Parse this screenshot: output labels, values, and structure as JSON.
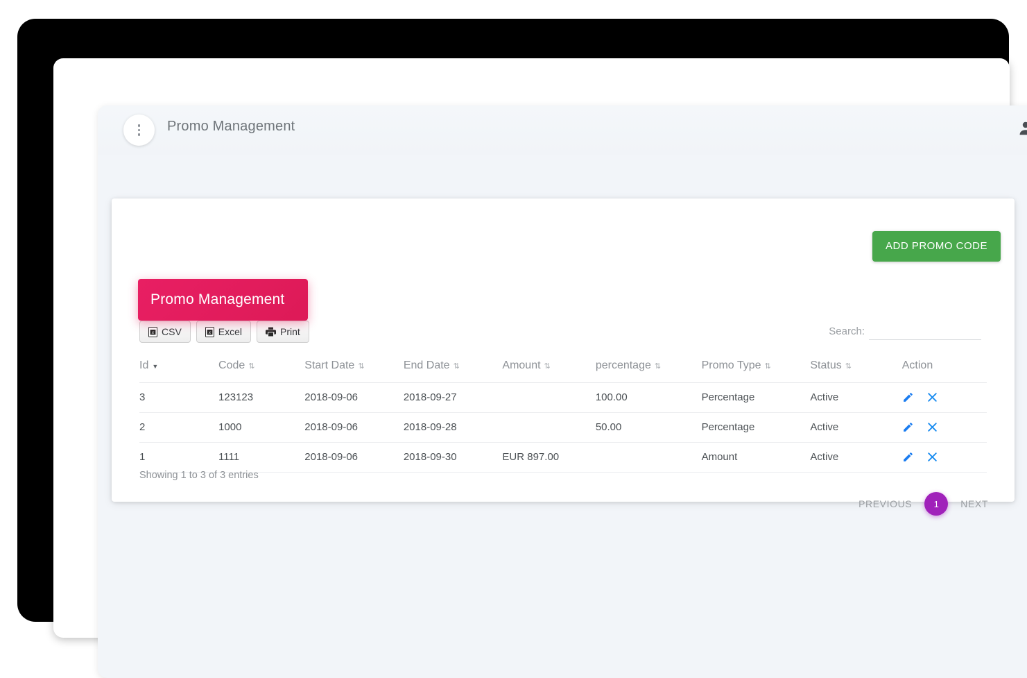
{
  "topbar": {
    "title": "Promo Management",
    "menu_icon": "more-vert-icon",
    "user_icon": "user-account-icon"
  },
  "card": {
    "ribbon_title": "Promo Management",
    "ribbon_color": "#e0245e",
    "add_button_label": "ADD PROMO CODE",
    "add_button_color": "#4caf50"
  },
  "export_buttons": [
    {
      "label": "CSV",
      "icon": "file-excel-icon"
    },
    {
      "label": "Excel",
      "icon": "file-excel-icon"
    },
    {
      "label": "Print",
      "icon": "printer-icon"
    }
  ],
  "search": {
    "label": "Search:",
    "value": "",
    "placeholder": ""
  },
  "table": {
    "columns": [
      {
        "label": "Id",
        "sortable": true,
        "sorted": "desc"
      },
      {
        "label": "Code",
        "sortable": true,
        "sorted": "none"
      },
      {
        "label": "Start Date",
        "sortable": true,
        "sorted": "none"
      },
      {
        "label": "End Date",
        "sortable": true,
        "sorted": "none"
      },
      {
        "label": "Amount",
        "sortable": true,
        "sorted": "none"
      },
      {
        "label": "percentage",
        "sortable": true,
        "sorted": "none"
      },
      {
        "label": "Promo Type",
        "sortable": true,
        "sorted": "none"
      },
      {
        "label": "Status",
        "sortable": true,
        "sorted": "none"
      },
      {
        "label": "Action",
        "sortable": false,
        "sorted": "none"
      }
    ],
    "rows": [
      {
        "id": "3",
        "code": "123123",
        "start_date": "2018-09-06",
        "end_date": "2018-09-27",
        "amount": "",
        "percentage": "100.00",
        "promo_type": "Percentage",
        "status": "Active",
        "edit_icon": "pencil-icon",
        "delete_icon": "close-x-icon"
      },
      {
        "id": "2",
        "code": "1000",
        "start_date": "2018-09-06",
        "end_date": "2018-09-28",
        "amount": "",
        "percentage": "50.00",
        "promo_type": "Percentage",
        "status": "Active",
        "edit_icon": "pencil-icon",
        "delete_icon": "close-x-icon"
      },
      {
        "id": "1",
        "code": "1111",
        "start_date": "2018-09-06",
        "end_date": "2018-09-30",
        "amount": "EUR 897.00",
        "percentage": "",
        "promo_type": "Amount",
        "status": "Active",
        "edit_icon": "pencil-icon",
        "delete_icon": "close-x-icon"
      }
    ]
  },
  "footer": {
    "showing_info": "Showing 1 to 3 of 3 entries",
    "previous_label": "PREVIOUS",
    "next_label": "NEXT",
    "current_page": "1",
    "current_page_color": "#9c27b0"
  }
}
